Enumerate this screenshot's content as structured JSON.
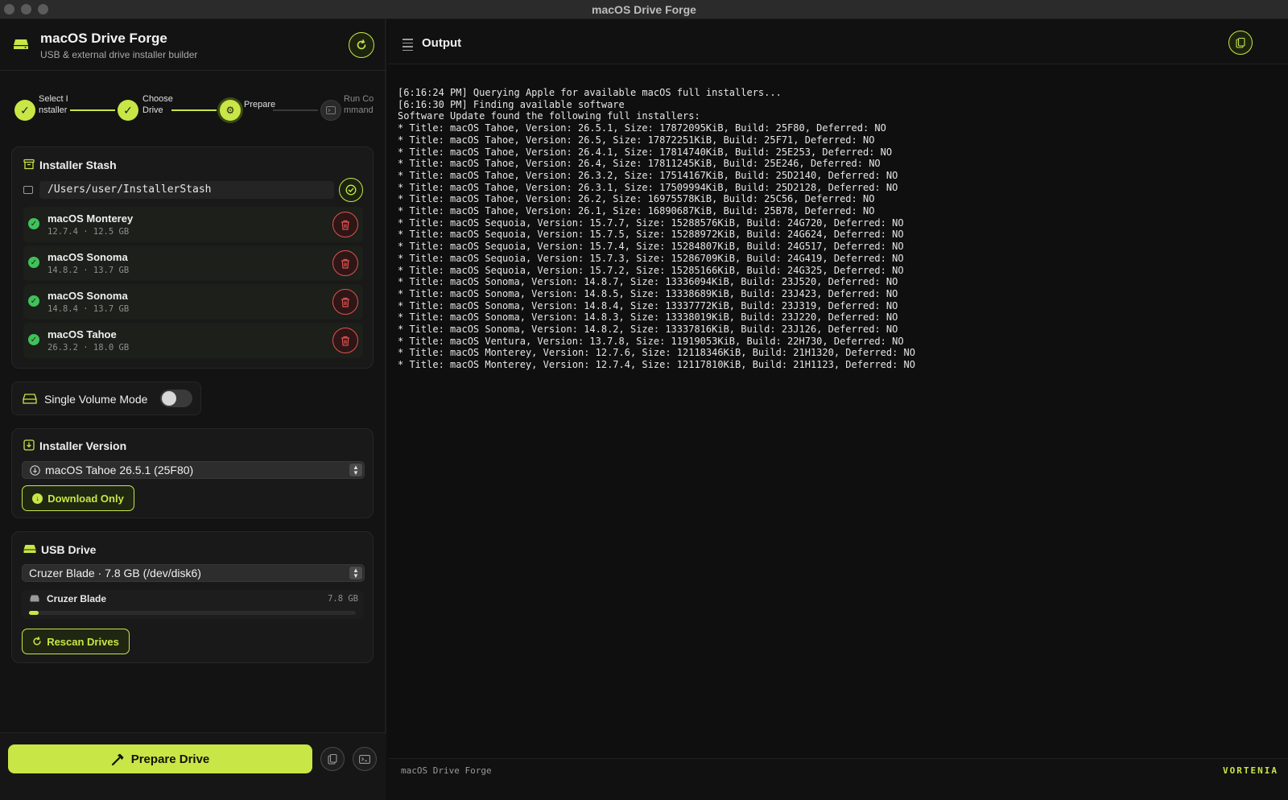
{
  "window": {
    "title": "macOS Drive Forge"
  },
  "app": {
    "name": "macOS Drive Forge",
    "subtitle": "USB & external drive installer builder"
  },
  "colors": {
    "accent": "#c8e646",
    "danger": "#e05252",
    "success": "#3fc25a",
    "background": "#0f0f0f"
  },
  "stepper": {
    "steps": [
      {
        "label": "Select Installer",
        "state": "done",
        "icon": "check-icon"
      },
      {
        "label": "Choose Drive",
        "state": "done",
        "icon": "check-icon"
      },
      {
        "label": "Prepare",
        "state": "active",
        "icon": "gear-icon"
      },
      {
        "label": "Run Command",
        "state": "idle",
        "icon": "terminal-icon"
      }
    ]
  },
  "stash": {
    "title": "Installer Stash",
    "path": "/Users/user/InstallerStash",
    "items": [
      {
        "name": "macOS Monterey",
        "meta": "12.7.4 · 12.5 GB"
      },
      {
        "name": "macOS Sonoma",
        "meta": "14.8.2 · 13.7 GB"
      },
      {
        "name": "macOS Sonoma",
        "meta": "14.8.4 · 13.7 GB"
      },
      {
        "name": "macOS Tahoe",
        "meta": "26.3.2 · 18.0 GB"
      }
    ]
  },
  "single_volume": {
    "label": "Single Volume Mode",
    "enabled": false
  },
  "installer_version": {
    "title": "Installer Version",
    "selected": "macOS Tahoe 26.5.1 (25F80)",
    "download_label": "Download Only"
  },
  "usb_drive": {
    "title": "USB Drive",
    "selected": "Cruzer Blade · 7.8 GB (/dev/disk6)",
    "drive_name": "Cruzer Blade",
    "drive_size": "7.8 GB",
    "usage_fraction": 0.03,
    "rescan_label": "Rescan Drives"
  },
  "bottom": {
    "prepare_label": "Prepare Drive"
  },
  "output": {
    "title": "Output",
    "lines": [
      "[6:16:24 PM] Querying Apple for available macOS full installers...",
      "[6:16:30 PM] Finding available software",
      "Software Update found the following full installers:",
      "* Title: macOS Tahoe, Version: 26.5.1, Size: 17872095KiB, Build: 25F80, Deferred: NO",
      "* Title: macOS Tahoe, Version: 26.5, Size: 17872251KiB, Build: 25F71, Deferred: NO",
      "* Title: macOS Tahoe, Version: 26.4.1, Size: 17814740KiB, Build: 25E253, Deferred: NO",
      "* Title: macOS Tahoe, Version: 26.4, Size: 17811245KiB, Build: 25E246, Deferred: NO",
      "* Title: macOS Tahoe, Version: 26.3.2, Size: 17514167KiB, Build: 25D2140, Deferred: NO",
      "* Title: macOS Tahoe, Version: 26.3.1, Size: 17509994KiB, Build: 25D2128, Deferred: NO",
      "* Title: macOS Tahoe, Version: 26.2, Size: 16975578KiB, Build: 25C56, Deferred: NO",
      "* Title: macOS Tahoe, Version: 26.1, Size: 16890687KiB, Build: 25B78, Deferred: NO",
      "* Title: macOS Sequoia, Version: 15.7.7, Size: 15288576KiB, Build: 24G720, Deferred: NO",
      "* Title: macOS Sequoia, Version: 15.7.5, Size: 15288972KiB, Build: 24G624, Deferred: NO",
      "* Title: macOS Sequoia, Version: 15.7.4, Size: 15284807KiB, Build: 24G517, Deferred: NO",
      "* Title: macOS Sequoia, Version: 15.7.3, Size: 15286709KiB, Build: 24G419, Deferred: NO",
      "* Title: macOS Sequoia, Version: 15.7.2, Size: 15285166KiB, Build: 24G325, Deferred: NO",
      "* Title: macOS Sonoma, Version: 14.8.7, Size: 13336094KiB, Build: 23J520, Deferred: NO",
      "* Title: macOS Sonoma, Version: 14.8.5, Size: 13338689KiB, Build: 23J423, Deferred: NO",
      "* Title: macOS Sonoma, Version: 14.8.4, Size: 13337772KiB, Build: 23J319, Deferred: NO",
      "* Title: macOS Sonoma, Version: 14.8.3, Size: 13338019KiB, Build: 23J220, Deferred: NO",
      "* Title: macOS Sonoma, Version: 14.8.2, Size: 13337816KiB, Build: 23J126, Deferred: NO",
      "* Title: macOS Ventura, Version: 13.7.8, Size: 11919053KiB, Build: 22H730, Deferred: NO",
      "* Title: macOS Monterey, Version: 12.7.6, Size: 12118346KiB, Build: 21H1320, Deferred: NO",
      "* Title: macOS Monterey, Version: 12.7.4, Size: 12117810KiB, Build: 21H1123, Deferred: NO"
    ]
  },
  "status": {
    "left": "macOS Drive Forge",
    "right": "VORTENIA"
  }
}
